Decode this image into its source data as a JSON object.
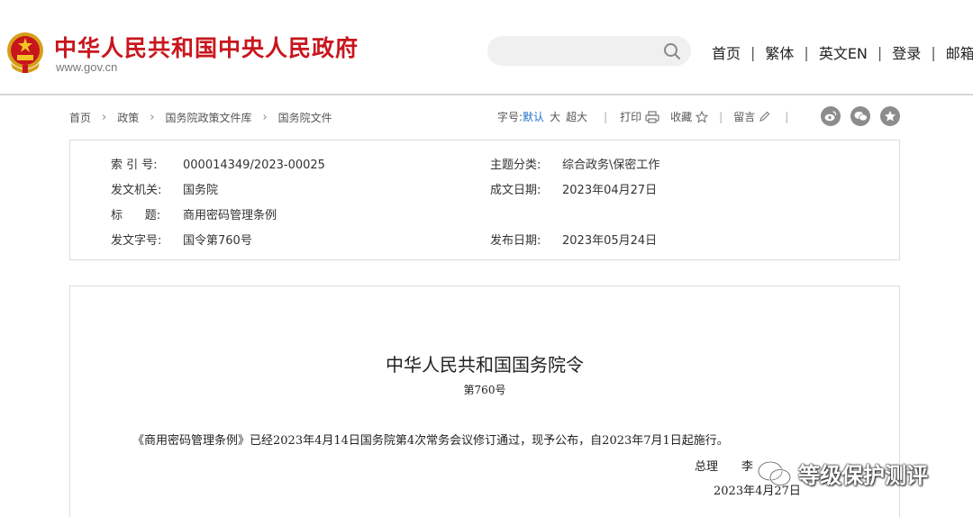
{
  "header": {
    "site_title": "中华人民共和国中央人民政府",
    "site_url": "www.gov.cn",
    "search": {
      "value": "",
      "placeholder": ""
    },
    "nav": [
      "首页",
      "繁体",
      "英文EN",
      "登录",
      "邮箱"
    ]
  },
  "breadcrumb": [
    "首页",
    "政策",
    "国务院政策文件库",
    "国务院文件"
  ],
  "tools": {
    "font_label": "字号:",
    "font_default": "默认",
    "font_large": "大",
    "font_xlarge": "超大",
    "print": "打印",
    "favorite": "收藏",
    "comment": "留言"
  },
  "share_icons": [
    "weibo-icon",
    "wechat-icon",
    "qzone-icon"
  ],
  "info": {
    "index_label": "索 引 号:",
    "index_value": "000014349/2023-00025",
    "topic_label": "主题分类:",
    "topic_value": "综合政务\\保密工作",
    "issuer_label": "发文机关:",
    "issuer_value": "国务院",
    "written_label": "成文日期:",
    "written_value": "2023年04月27日",
    "title_label": "标      题:",
    "title_value": "商用密码管理条例",
    "docno_label": "发文字号:",
    "docno_value": "国令第760号",
    "published_label": "发布日期:",
    "published_value": "2023年05月24日"
  },
  "document": {
    "title": "中华人民共和国国务院令",
    "number": "第760号",
    "paragraph": "《商用密码管理条例》已经2023年4月14日国务院第4次常务会议修订通过，现予公布，自2023年7月1日起施行。",
    "sign_title": "总理　　李",
    "sign_date": "2023年4月27日"
  },
  "watermark": {
    "text": "等级保护测评",
    "icon": "wechat-icon"
  },
  "colors": {
    "brand_red": "#c8161d",
    "link_blue": "#1d6fd0",
    "border": "#dcdcdc"
  }
}
